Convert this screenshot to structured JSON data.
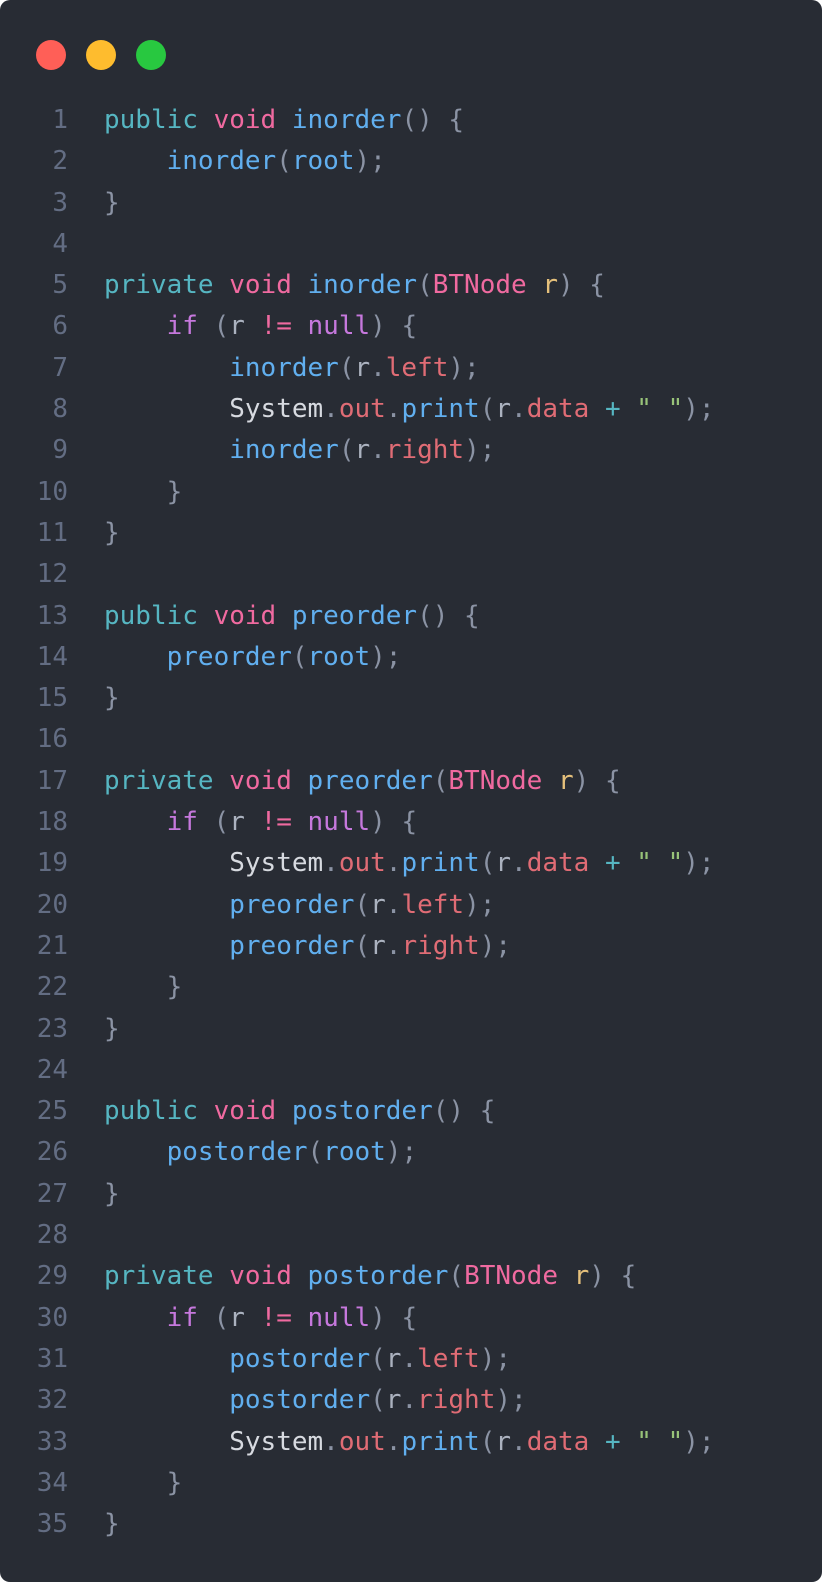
{
  "window": {
    "buttons": {
      "close_color": "#ff5f57",
      "minimize_color": "#febc2e",
      "maximize_color": "#28c840"
    }
  },
  "code": {
    "language": "java",
    "lines": [
      {
        "n": "1",
        "tokens": [
          [
            "public",
            "mod"
          ],
          [
            " ",
            "plain"
          ],
          [
            "void",
            "kw"
          ],
          [
            " ",
            "plain"
          ],
          [
            "inorder",
            "fn"
          ],
          [
            "() {",
            "punc"
          ]
        ]
      },
      {
        "n": "2",
        "tokens": [
          [
            "    ",
            "plain"
          ],
          [
            "inorder",
            "fn"
          ],
          [
            "(",
            "punc"
          ],
          [
            "root",
            "fn"
          ],
          [
            ");",
            "punc"
          ]
        ]
      },
      {
        "n": "3",
        "tokens": [
          [
            "}",
            "punc"
          ]
        ]
      },
      {
        "n": "4",
        "tokens": []
      },
      {
        "n": "5",
        "tokens": [
          [
            "private",
            "mod"
          ],
          [
            " ",
            "plain"
          ],
          [
            "void",
            "kw"
          ],
          [
            " ",
            "plain"
          ],
          [
            "inorder",
            "fn"
          ],
          [
            "(",
            "punc"
          ],
          [
            "BTNode",
            "type"
          ],
          [
            " ",
            "plain"
          ],
          [
            "r",
            "param"
          ],
          [
            ") {",
            "punc"
          ]
        ]
      },
      {
        "n": "6",
        "tokens": [
          [
            "    ",
            "plain"
          ],
          [
            "if",
            "ctl"
          ],
          [
            " (",
            "punc"
          ],
          [
            "r",
            "var"
          ],
          [
            " ",
            "plain"
          ],
          [
            "!=",
            "kw"
          ],
          [
            " ",
            "plain"
          ],
          [
            "null",
            "ctl"
          ],
          [
            ") {",
            "punc"
          ]
        ]
      },
      {
        "n": "7",
        "tokens": [
          [
            "        ",
            "plain"
          ],
          [
            "inorder",
            "fn"
          ],
          [
            "(",
            "punc"
          ],
          [
            "r",
            "var"
          ],
          [
            ".",
            "punc"
          ],
          [
            "left",
            "prop"
          ],
          [
            ");",
            "punc"
          ]
        ]
      },
      {
        "n": "8",
        "tokens": [
          [
            "        ",
            "plain"
          ],
          [
            "System",
            "cls"
          ],
          [
            ".",
            "punc"
          ],
          [
            "out",
            "prop"
          ],
          [
            ".",
            "punc"
          ],
          [
            "print",
            "fn"
          ],
          [
            "(",
            "punc"
          ],
          [
            "r",
            "var"
          ],
          [
            ".",
            "punc"
          ],
          [
            "data",
            "prop"
          ],
          [
            " ",
            "plain"
          ],
          [
            "+",
            "op"
          ],
          [
            " ",
            "plain"
          ],
          [
            "\" \"",
            "str"
          ],
          [
            ");",
            "punc"
          ]
        ]
      },
      {
        "n": "9",
        "tokens": [
          [
            "        ",
            "plain"
          ],
          [
            "inorder",
            "fn"
          ],
          [
            "(",
            "punc"
          ],
          [
            "r",
            "var"
          ],
          [
            ".",
            "punc"
          ],
          [
            "right",
            "prop"
          ],
          [
            ");",
            "punc"
          ]
        ]
      },
      {
        "n": "10",
        "tokens": [
          [
            "    ",
            "plain"
          ],
          [
            "}",
            "punc"
          ]
        ]
      },
      {
        "n": "11",
        "tokens": [
          [
            "}",
            "punc"
          ]
        ]
      },
      {
        "n": "12",
        "tokens": []
      },
      {
        "n": "13",
        "tokens": [
          [
            "public",
            "mod"
          ],
          [
            " ",
            "plain"
          ],
          [
            "void",
            "kw"
          ],
          [
            " ",
            "plain"
          ],
          [
            "preorder",
            "fn"
          ],
          [
            "() {",
            "punc"
          ]
        ]
      },
      {
        "n": "14",
        "tokens": [
          [
            "    ",
            "plain"
          ],
          [
            "preorder",
            "fn"
          ],
          [
            "(",
            "punc"
          ],
          [
            "root",
            "fn"
          ],
          [
            ");",
            "punc"
          ]
        ]
      },
      {
        "n": "15",
        "tokens": [
          [
            "}",
            "punc"
          ]
        ]
      },
      {
        "n": "16",
        "tokens": []
      },
      {
        "n": "17",
        "tokens": [
          [
            "private",
            "mod"
          ],
          [
            " ",
            "plain"
          ],
          [
            "void",
            "kw"
          ],
          [
            " ",
            "plain"
          ],
          [
            "preorder",
            "fn"
          ],
          [
            "(",
            "punc"
          ],
          [
            "BTNode",
            "type"
          ],
          [
            " ",
            "plain"
          ],
          [
            "r",
            "param"
          ],
          [
            ") {",
            "punc"
          ]
        ]
      },
      {
        "n": "18",
        "tokens": [
          [
            "    ",
            "plain"
          ],
          [
            "if",
            "ctl"
          ],
          [
            " (",
            "punc"
          ],
          [
            "r",
            "var"
          ],
          [
            " ",
            "plain"
          ],
          [
            "!=",
            "kw"
          ],
          [
            " ",
            "plain"
          ],
          [
            "null",
            "ctl"
          ],
          [
            ") {",
            "punc"
          ]
        ]
      },
      {
        "n": "19",
        "tokens": [
          [
            "        ",
            "plain"
          ],
          [
            "System",
            "cls"
          ],
          [
            ".",
            "punc"
          ],
          [
            "out",
            "prop"
          ],
          [
            ".",
            "punc"
          ],
          [
            "print",
            "fn"
          ],
          [
            "(",
            "punc"
          ],
          [
            "r",
            "var"
          ],
          [
            ".",
            "punc"
          ],
          [
            "data",
            "prop"
          ],
          [
            " ",
            "plain"
          ],
          [
            "+",
            "op"
          ],
          [
            " ",
            "plain"
          ],
          [
            "\" \"",
            "str"
          ],
          [
            ");",
            "punc"
          ]
        ]
      },
      {
        "n": "20",
        "tokens": [
          [
            "        ",
            "plain"
          ],
          [
            "preorder",
            "fn"
          ],
          [
            "(",
            "punc"
          ],
          [
            "r",
            "var"
          ],
          [
            ".",
            "punc"
          ],
          [
            "left",
            "prop"
          ],
          [
            ");",
            "punc"
          ]
        ]
      },
      {
        "n": "21",
        "tokens": [
          [
            "        ",
            "plain"
          ],
          [
            "preorder",
            "fn"
          ],
          [
            "(",
            "punc"
          ],
          [
            "r",
            "var"
          ],
          [
            ".",
            "punc"
          ],
          [
            "right",
            "prop"
          ],
          [
            ");",
            "punc"
          ]
        ]
      },
      {
        "n": "22",
        "tokens": [
          [
            "    ",
            "plain"
          ],
          [
            "}",
            "punc"
          ]
        ]
      },
      {
        "n": "23",
        "tokens": [
          [
            "}",
            "punc"
          ]
        ]
      },
      {
        "n": "24",
        "tokens": []
      },
      {
        "n": "25",
        "tokens": [
          [
            "public",
            "mod"
          ],
          [
            " ",
            "plain"
          ],
          [
            "void",
            "kw"
          ],
          [
            " ",
            "plain"
          ],
          [
            "postorder",
            "fn"
          ],
          [
            "() {",
            "punc"
          ]
        ]
      },
      {
        "n": "26",
        "tokens": [
          [
            "    ",
            "plain"
          ],
          [
            "postorder",
            "fn"
          ],
          [
            "(",
            "punc"
          ],
          [
            "root",
            "fn"
          ],
          [
            ");",
            "punc"
          ]
        ]
      },
      {
        "n": "27",
        "tokens": [
          [
            "}",
            "punc"
          ]
        ]
      },
      {
        "n": "28",
        "tokens": []
      },
      {
        "n": "29",
        "tokens": [
          [
            "private",
            "mod"
          ],
          [
            " ",
            "plain"
          ],
          [
            "void",
            "kw"
          ],
          [
            " ",
            "plain"
          ],
          [
            "postorder",
            "fn"
          ],
          [
            "(",
            "punc"
          ],
          [
            "BTNode",
            "type"
          ],
          [
            " ",
            "plain"
          ],
          [
            "r",
            "param"
          ],
          [
            ") {",
            "punc"
          ]
        ]
      },
      {
        "n": "30",
        "tokens": [
          [
            "    ",
            "plain"
          ],
          [
            "if",
            "ctl"
          ],
          [
            " (",
            "punc"
          ],
          [
            "r",
            "var"
          ],
          [
            " ",
            "plain"
          ],
          [
            "!=",
            "kw"
          ],
          [
            " ",
            "plain"
          ],
          [
            "null",
            "ctl"
          ],
          [
            ") {",
            "punc"
          ]
        ]
      },
      {
        "n": "31",
        "tokens": [
          [
            "        ",
            "plain"
          ],
          [
            "postorder",
            "fn"
          ],
          [
            "(",
            "punc"
          ],
          [
            "r",
            "var"
          ],
          [
            ".",
            "punc"
          ],
          [
            "left",
            "prop"
          ],
          [
            ");",
            "punc"
          ]
        ]
      },
      {
        "n": "32",
        "tokens": [
          [
            "        ",
            "plain"
          ],
          [
            "postorder",
            "fn"
          ],
          [
            "(",
            "punc"
          ],
          [
            "r",
            "var"
          ],
          [
            ".",
            "punc"
          ],
          [
            "right",
            "prop"
          ],
          [
            ");",
            "punc"
          ]
        ]
      },
      {
        "n": "33",
        "tokens": [
          [
            "        ",
            "plain"
          ],
          [
            "System",
            "cls"
          ],
          [
            ".",
            "punc"
          ],
          [
            "out",
            "prop"
          ],
          [
            ".",
            "punc"
          ],
          [
            "print",
            "fn"
          ],
          [
            "(",
            "punc"
          ],
          [
            "r",
            "var"
          ],
          [
            ".",
            "punc"
          ],
          [
            "data",
            "prop"
          ],
          [
            " ",
            "plain"
          ],
          [
            "+",
            "op"
          ],
          [
            " ",
            "plain"
          ],
          [
            "\" \"",
            "str"
          ],
          [
            ");",
            "punc"
          ]
        ]
      },
      {
        "n": "34",
        "tokens": [
          [
            "    ",
            "plain"
          ],
          [
            "}",
            "punc"
          ]
        ]
      },
      {
        "n": "35",
        "tokens": [
          [
            "}",
            "punc"
          ]
        ]
      }
    ]
  }
}
